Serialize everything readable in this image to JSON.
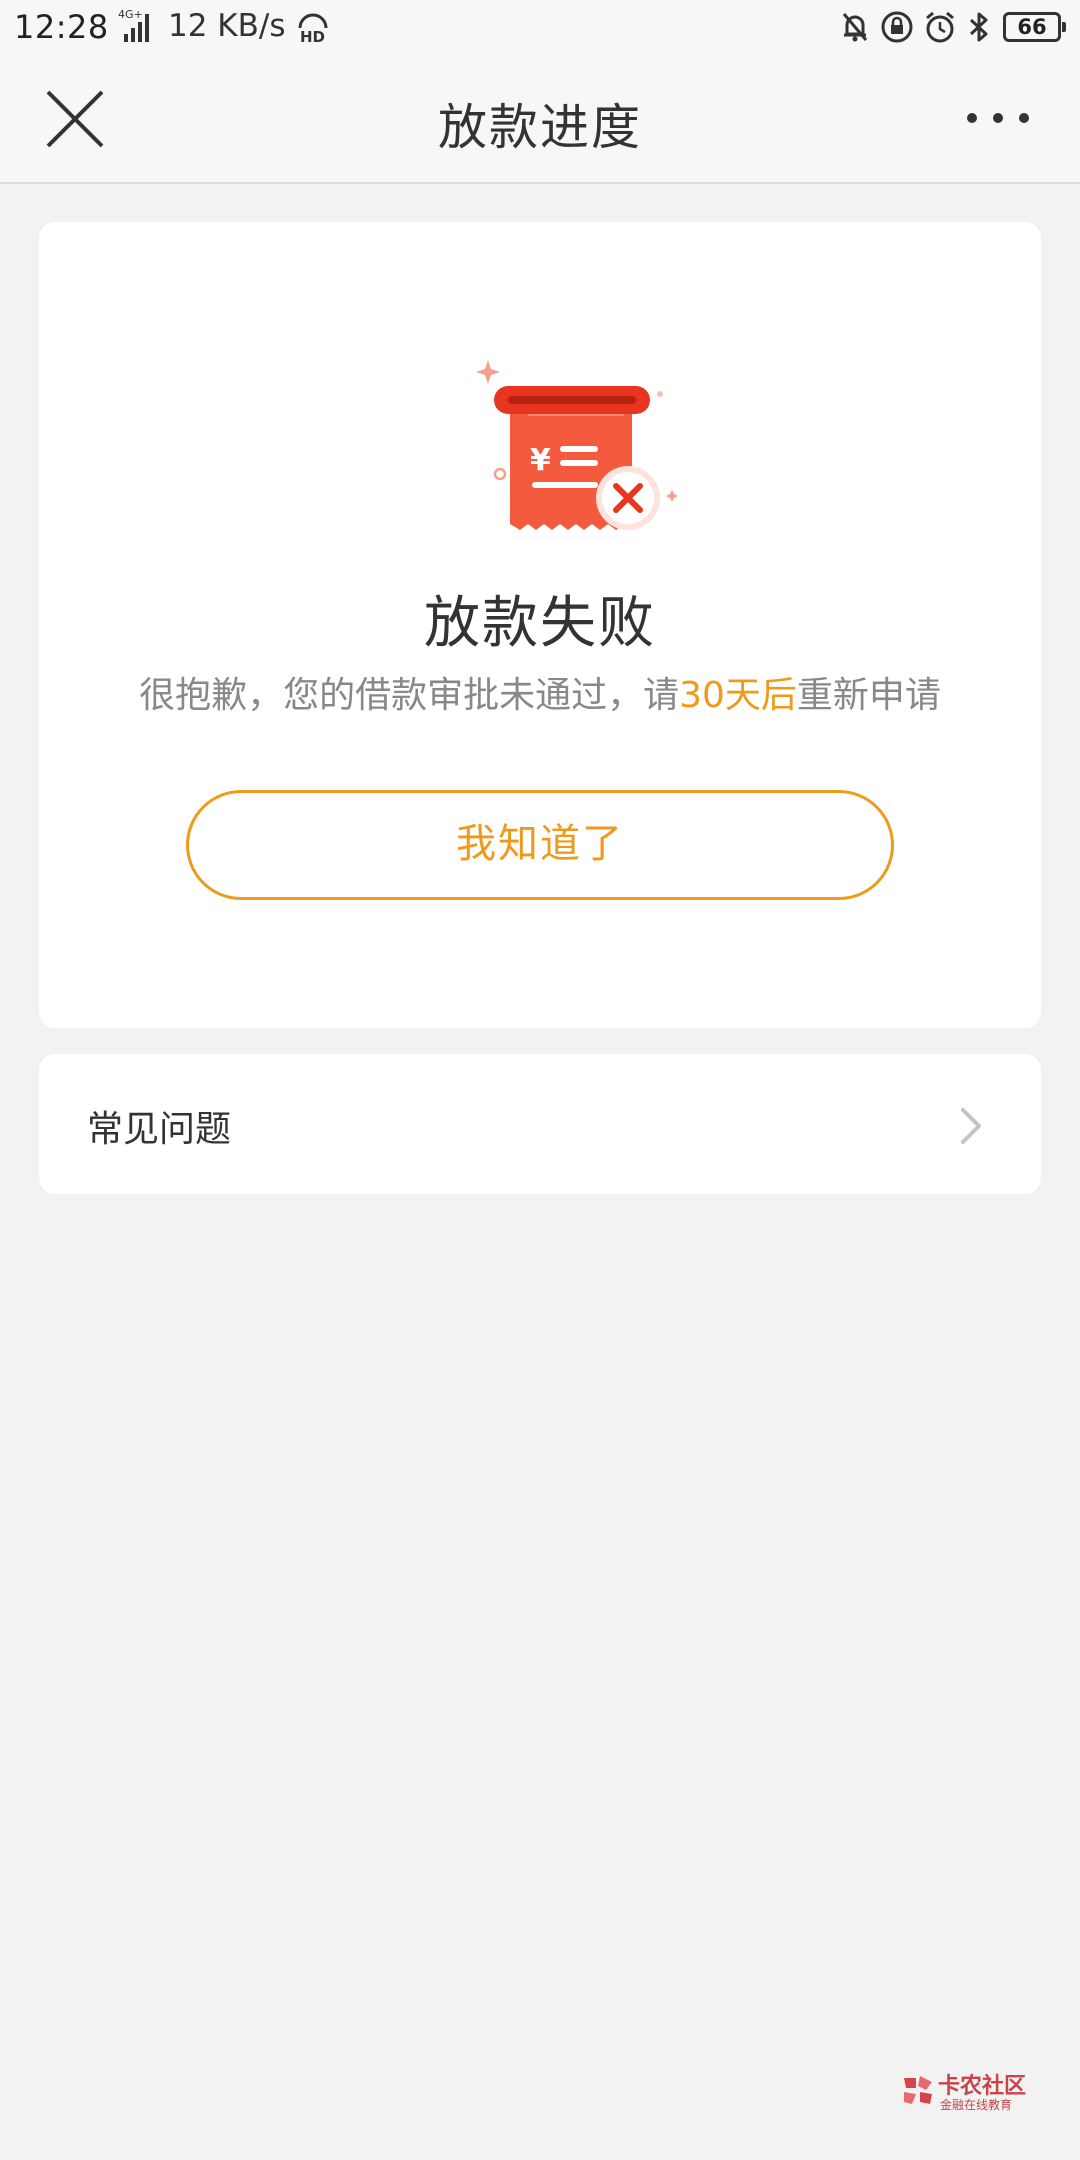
{
  "status_bar": {
    "time": "12:28",
    "network": "4G+",
    "speed": "12 KB/s",
    "battery": "66"
  },
  "nav": {
    "title": "放款进度"
  },
  "result": {
    "title": "放款失败",
    "desc_prefix": "很抱歉，您的借款审批未通过，请",
    "desc_highlight": "30天后",
    "desc_suffix": "重新申请",
    "button_label": "我知道了"
  },
  "faq": {
    "label": "常见问题"
  },
  "watermark": {
    "name": "卡农社区",
    "sub": "金融在线教育"
  },
  "colors": {
    "accent": "#ee9a1a",
    "error_red": "#f0452c",
    "background": "#f2f2f2"
  }
}
